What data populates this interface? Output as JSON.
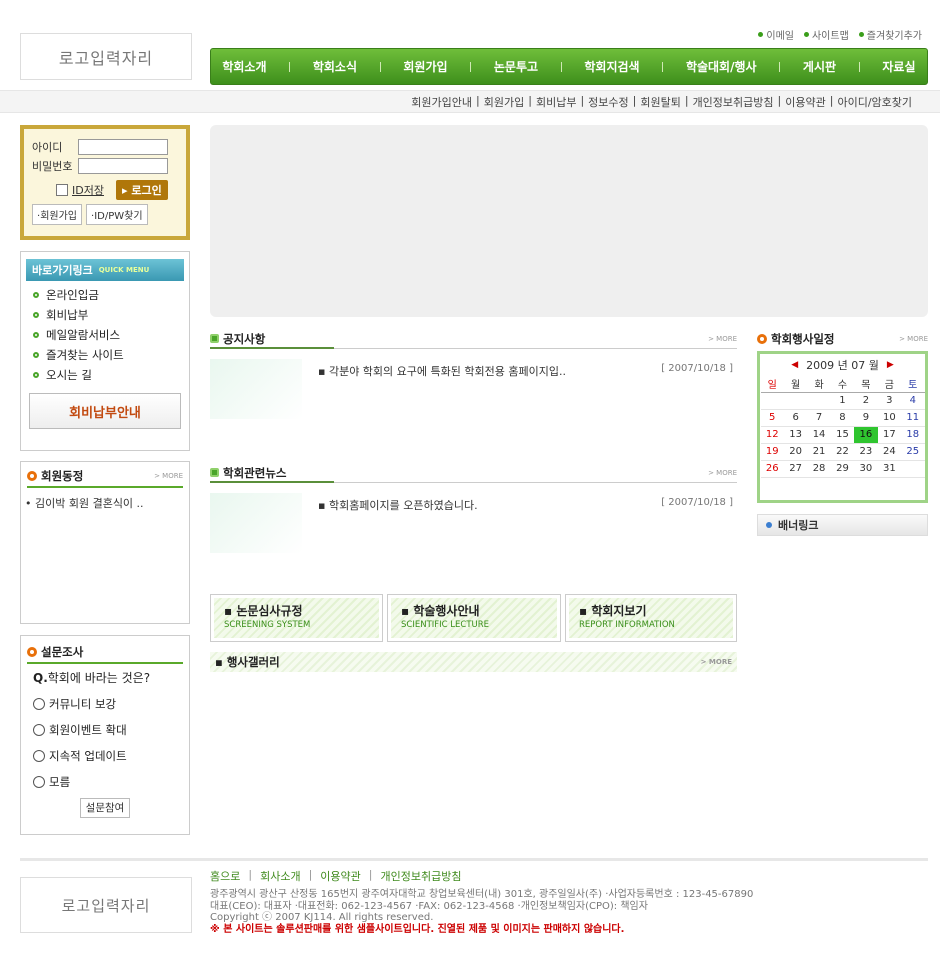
{
  "logo_placeholder": "로고입력자리",
  "util_links": [
    "이메일",
    "사이트맵",
    "즐겨찾기추가"
  ],
  "gnb": [
    "학회소개",
    "학회소식",
    "회원가입",
    "논문투고",
    "학회지검색",
    "학술대회/행사",
    "게시판",
    "자료실"
  ],
  "subnav": [
    "회원가입안내",
    "회원가입",
    "회비납부",
    "정보수정",
    "회원탈퇴",
    "개인정보취급방침",
    "이용약관",
    "아이디/암호찾기"
  ],
  "subnav_sep": "|",
  "login": {
    "id_label": "아이디",
    "pw_label": "비밀번호",
    "save_id": "ID저장",
    "login_btn": "로그인",
    "join_btn": "회원가입",
    "find_btn": "ID/PW찾기"
  },
  "quick": {
    "title": "바로가기링크",
    "sub": "QUICK MENU",
    "items": [
      "온라인입금",
      "회비납부",
      "메일알람서비스",
      "즐겨찾는 사이트",
      "오시는 길"
    ],
    "pay_btn": "회비납부안내"
  },
  "member_news": {
    "title": "회원동정",
    "more": "> MORE",
    "items": [
      "• 김이박 회원 결혼식이 .."
    ]
  },
  "poll": {
    "title": "설문조사",
    "q_mark": "Q.",
    "question": "학회에 바라는 것은?",
    "options": [
      "커뮤니티 보강",
      "회원이벤트 확대",
      "지속적 업데이트",
      "모름"
    ],
    "submit": "설문참여"
  },
  "notice": {
    "title": "공지사항",
    "more": "> MORE",
    "items": [
      {
        "text": "▪ 각분야 학회의 요구에 특화된 학회전용 홈페이지입..",
        "date": "[ 2007/10/18 ]"
      }
    ]
  },
  "news": {
    "title": "학회관련뉴스",
    "more": "> MORE",
    "items": [
      {
        "text": "▪ 학회홈페이지를 오픈하였습니다.",
        "date": "[ 2007/10/18 ]"
      }
    ]
  },
  "event_schedule": {
    "title": "학회행사일정",
    "more": "> MORE",
    "year": "2009",
    "year_label": "년",
    "month": "07",
    "month_label": "월",
    "weekdays": [
      "일",
      "월",
      "화",
      "수",
      "목",
      "금",
      "토"
    ],
    "weeks": [
      [
        "",
        "",
        "",
        "1",
        "2",
        "3",
        "4"
      ],
      [
        "5",
        "6",
        "7",
        "8",
        "9",
        "10",
        "11"
      ],
      [
        "12",
        "13",
        "14",
        "15",
        "16",
        "17",
        "18"
      ],
      [
        "19",
        "20",
        "21",
        "22",
        "23",
        "24",
        "25"
      ],
      [
        "26",
        "27",
        "28",
        "29",
        "30",
        "31",
        ""
      ]
    ],
    "today": "16"
  },
  "banner_link": "배너링크",
  "shortcuts": [
    {
      "title": "논문심사규정",
      "sub": "SCREENING SYSTEM"
    },
    {
      "title": "학술행사안내",
      "sub": "SCIENTIFIC LECTURE"
    },
    {
      "title": "학회지보기",
      "sub": "REPORT INFORMATION"
    }
  ],
  "gallery": {
    "title": "행사갤러리",
    "more": "> MORE"
  },
  "footer": {
    "links": [
      "홈으로",
      "회사소개",
      "이용약관",
      "개인정보취급방침"
    ],
    "sep": "|",
    "address": "광주광역시 광산구 산정동 165번지 광주여자대학교 창업보육센터(내) 301호, 광주일일사(주) ·사업자등록번호 : 123-45-67890",
    "ceo": "대표(CEO): 대표자 ·대표전화: 062-123-4567 ·FAX: 062-123-4568 ·개인정보책임자(CPO): 책임자",
    "copyright": "Copyright ⓒ 2007 KJ114. All rights reserved.",
    "warning": "※ 본 사이트는 솔루션판매를 위한 샘플사이트입니다. 진열된 제품 및 이미지는 판매하지 않습니다."
  },
  "colors": {
    "brand_green": "#4aa52a",
    "today_highlight": "#2fc52f",
    "accent_orange": "#e8700a"
  }
}
